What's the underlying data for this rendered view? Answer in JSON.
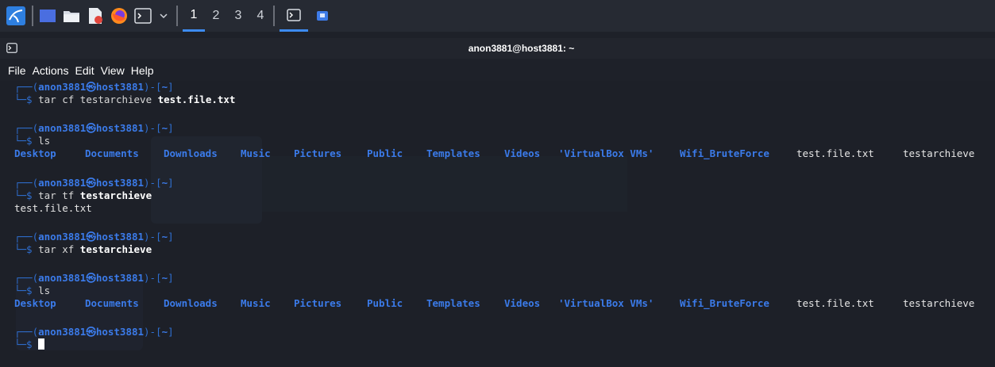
{
  "taskbar": {
    "workspaces": [
      "1",
      "2",
      "3",
      "4"
    ],
    "active_workspace": "1"
  },
  "window": {
    "title": "anon3881@host3881: ~"
  },
  "menu": [
    "File",
    "Actions",
    "Edit",
    "View",
    "Help"
  ],
  "prompt": {
    "open": "┌──(",
    "user": "anon3881㉿host3881",
    "close": ")-[",
    "dir": "~",
    "end": "]",
    "dollar_line": "└─$ "
  },
  "commands": [
    {
      "cmd": "tar cf testarchieve ",
      "arg": "test.file.txt"
    },
    {
      "cmd": "ls",
      "arg": ""
    },
    {
      "cmd": "tar tf ",
      "arg": "testarchieve"
    },
    {
      "cmd": "tar xf ",
      "arg": "testarchieve"
    },
    {
      "cmd": "ls",
      "arg": ""
    },
    {
      "cmd": "",
      "arg": ""
    }
  ],
  "outputs": {
    "tf_output": "test.file.txt"
  },
  "ls_listing": [
    {
      "name": "Desktop",
      "type": "dir"
    },
    {
      "name": "Documents",
      "type": "dir"
    },
    {
      "name": "Downloads",
      "type": "dir"
    },
    {
      "name": "Music",
      "type": "dir"
    },
    {
      "name": "Pictures",
      "type": "dir"
    },
    {
      "name": "Public",
      "type": "dir"
    },
    {
      "name": "Templates",
      "type": "dir"
    },
    {
      "name": "Videos",
      "type": "dir"
    },
    {
      "name": "'VirtualBox VMs'",
      "type": "dir"
    },
    {
      "name": "Wifi_BruteForce",
      "type": "dir"
    },
    {
      "name": "test.file.txt",
      "type": "file"
    },
    {
      "name": "testarchieve",
      "type": "file"
    }
  ],
  "colors": {
    "prompt_user": "#3b7bea",
    "prompt_bracket": "#2f6fd1",
    "accent": "#3d8bf2",
    "background": "#1d2028"
  }
}
